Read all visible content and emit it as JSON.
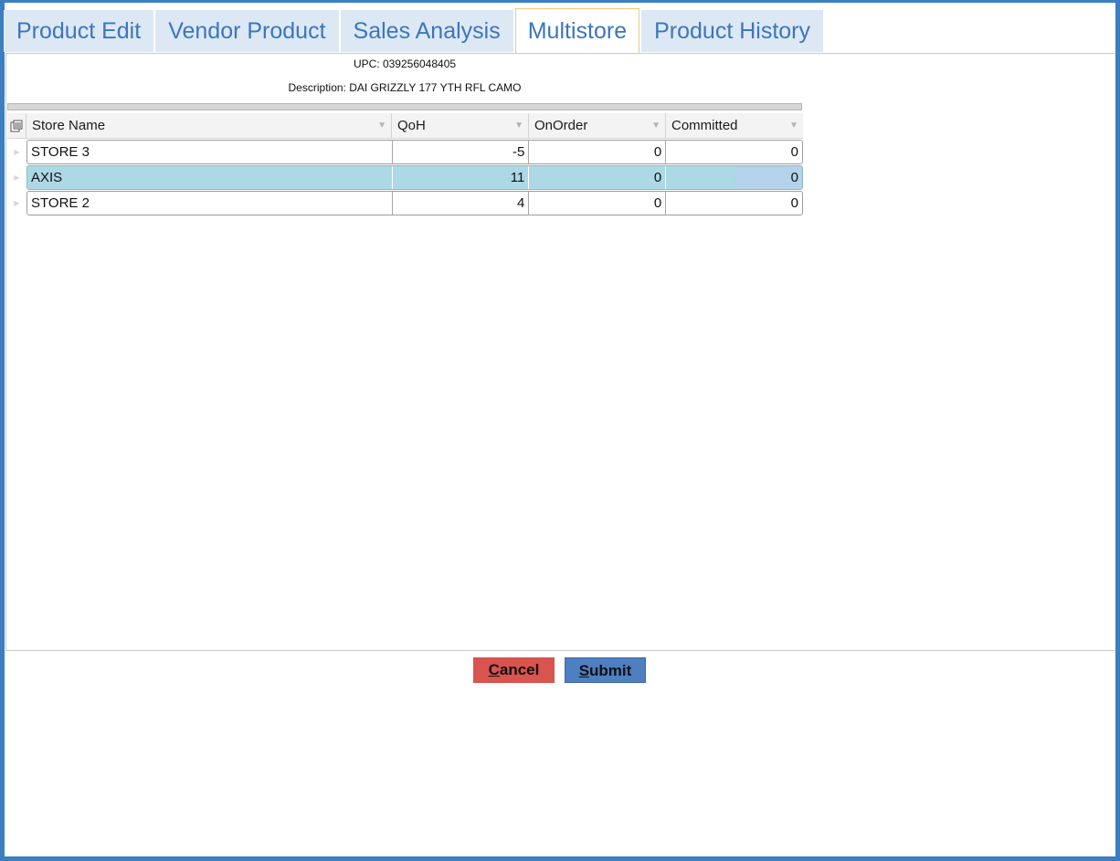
{
  "tabs": [
    {
      "label": "Product Edit",
      "active": false
    },
    {
      "label": "Vendor Product",
      "active": false
    },
    {
      "label": "Sales Analysis",
      "active": false
    },
    {
      "label": "Multistore",
      "active": true
    },
    {
      "label": "Product History",
      "active": false
    }
  ],
  "info": {
    "upc": "UPC: 039256048405",
    "description": "Description: DAI GRIZZLY 177 YTH RFL CAMO"
  },
  "grid": {
    "columns": [
      "Store Name",
      "QoH",
      "OnOrder",
      "Committed"
    ],
    "rows": [
      {
        "store": "STORE 3",
        "qoh": "-5",
        "onorder": "0",
        "committed": "0",
        "selected": false
      },
      {
        "store": "AXIS",
        "qoh": "11",
        "onorder": "0",
        "committed": "0",
        "selected": true
      },
      {
        "store": "STORE 2",
        "qoh": "4",
        "onorder": "0",
        "committed": "0",
        "selected": false
      }
    ]
  },
  "buttons": {
    "cancel_accel": "C",
    "cancel_rest": "ancel",
    "submit_accel": "S",
    "submit_rest": "ubmit"
  },
  "colors": {
    "frame": "#3c7fc0",
    "tab_bg": "#dde8f5",
    "tab_text": "#3b76bd",
    "active_tab_border": "#f1c87a",
    "selected_row": "#add8e6",
    "cancel_button": "#d9534f",
    "submit_button": "#4e7fc1"
  },
  "icons": {
    "column_chooser": "column-chooser-icon",
    "filter": "filter-icon",
    "row_indicator": "row-indicator-icon"
  }
}
